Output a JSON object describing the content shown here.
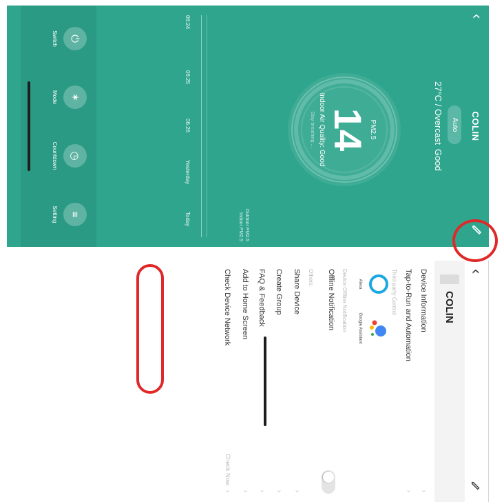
{
  "panel": {
    "title": "COLIN",
    "mode": "Auto",
    "weather": "27°C / Overcast",
    "weather_quality": "Good",
    "pm_label": "PM2.5",
    "pm_value": "14",
    "air_quality": "Indoor Air Quality: Good",
    "air_sub": "Stay breathing ...",
    "chart_legend": [
      "Outdoor PM2.5",
      "Indoor PM2.5"
    ],
    "chart_axis": [
      "06:24",
      "06:25",
      "06:26",
      "Yesterday",
      "Today"
    ],
    "controls": [
      {
        "label": "Switch",
        "icon": "power-icon"
      },
      {
        "label": "Mode",
        "icon": "fan-icon"
      },
      {
        "label": "Countdown",
        "icon": "timer-icon"
      },
      {
        "label": "Setting",
        "icon": "settings-icon"
      }
    ]
  },
  "settings": {
    "device_name": "COLIN",
    "device_information": "Device Information",
    "tap_to_run": "Tap-to-Run and Automation",
    "third_party_header": "Third-party Control",
    "alexa": "Alexa",
    "google": "Google Assistant",
    "offline_header": "Device Offline Notification",
    "offline_notification": "Offline Notification",
    "others_header": "Others",
    "share_device": "Share Device",
    "create_group": "Create Group",
    "faq": "FAQ & Feedback",
    "add_home": "Add to Home Screen",
    "check_network": "Check Device Network",
    "check_now": "Check Now"
  },
  "colors": {
    "panel_bg": "#2fa58e",
    "highlight": "#e02828",
    "alexa": "#1ca8e3",
    "google_blue": "#4285f4"
  }
}
